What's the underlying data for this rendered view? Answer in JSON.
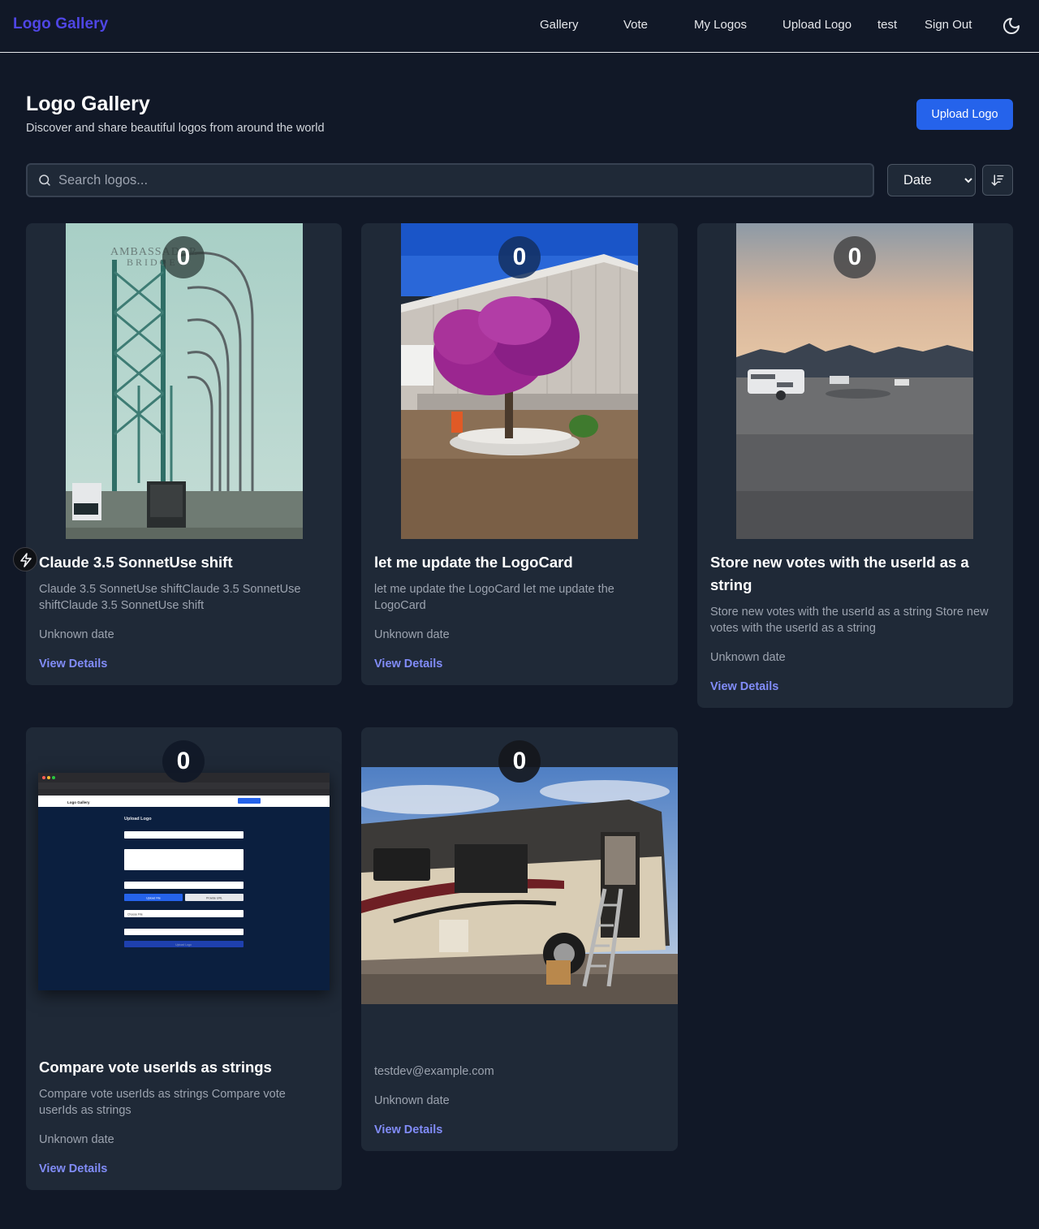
{
  "nav": {
    "brand": "Logo Gallery",
    "links": [
      "Gallery",
      "Vote",
      "My Logos",
      "Upload Logo"
    ],
    "user": "test",
    "sign_out": "Sign Out"
  },
  "header": {
    "title": "Logo Gallery",
    "subtitle": "Discover and share beautiful logos from around the world",
    "upload_label": "Upload Logo"
  },
  "search": {
    "placeholder": "Search logos..."
  },
  "sort": {
    "selected": "Date"
  },
  "screenshot_text": {
    "brand": "Logo Gallery",
    "upload_title": "Upload Logo",
    "btn_upload_file": "Upload File",
    "btn_provide_url": "Provide URL",
    "choose_file": "Choose File",
    "upload_logo_btn": "Upload Logo"
  },
  "cards": [
    {
      "votes": "0",
      "image": "bridge",
      "title": "Claude 3.5 SonnetUse shift",
      "description": "Claude 3.5 SonnetUse shiftClaude 3.5 SonnetUse shiftClaude 3.5 SonnetUse shift",
      "date": "Unknown date",
      "link": "View Details"
    },
    {
      "votes": "0",
      "image": "flowering-tree",
      "title": "let me update the LogoCard",
      "description": "let me update the LogoCard let me update the LogoCard",
      "date": "Unknown date",
      "link": "View Details"
    },
    {
      "votes": "0",
      "image": "desert-campground",
      "title": "Store new votes with the userId as a string",
      "description": "Store new votes with the userId as a string Store new votes with the userId as a string",
      "date": "Unknown date",
      "link": "View Details"
    },
    {
      "votes": "0",
      "image": "upload-form-screenshot",
      "title": "Compare vote userIds as strings",
      "description": "Compare vote userIds as strings Compare vote userIds as strings",
      "date": "Unknown date",
      "link": "View Details"
    },
    {
      "votes": "0",
      "image": "motorhome",
      "owner": "testdev@example.com",
      "date": "Unknown date",
      "link": "View Details"
    }
  ]
}
